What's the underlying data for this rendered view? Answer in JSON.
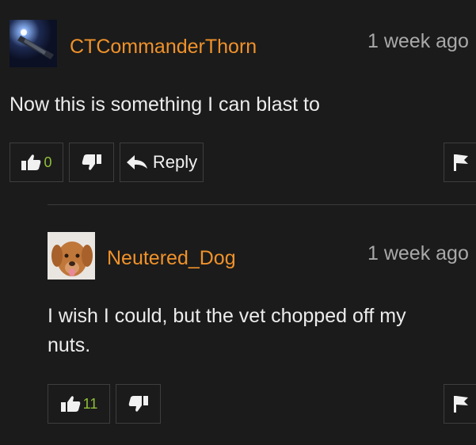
{
  "colors": {
    "background": "#1b1b1b",
    "username": "#f0922a",
    "timestamp": "#a9a9a9",
    "text": "#ececec",
    "vote_count": "#8fbf3a",
    "button_border": "#3e3e3e"
  },
  "comments": [
    {
      "username": "CTCommanderThorn",
      "timestamp": "1 week ago",
      "text": "Now this is something I can blast to",
      "likes": "0",
      "reply_label": "Reply",
      "icons": [
        "thumbs-up-icon",
        "thumbs-down-icon",
        "reply-arrow-icon",
        "flag-icon"
      ]
    },
    {
      "username": "Neutered_Dog",
      "timestamp": "1 week ago",
      "text": "I wish I could, but the vet chopped off my nuts.",
      "likes": "11",
      "icons": [
        "thumbs-up-icon",
        "thumbs-down-icon",
        "flag-icon"
      ]
    }
  ]
}
